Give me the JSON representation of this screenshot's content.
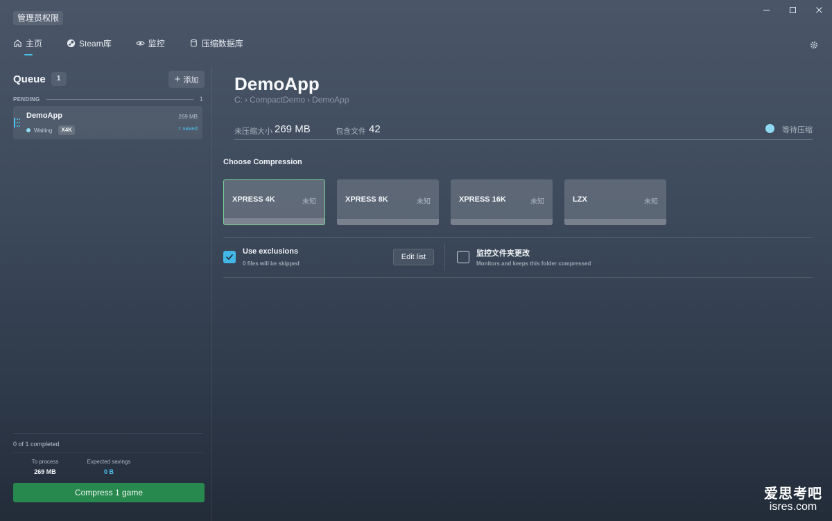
{
  "titlebar": {
    "admin_badge": "管理员权限"
  },
  "nav": {
    "items": [
      {
        "label": "主页",
        "icon": "home-icon",
        "active": true
      },
      {
        "label": "Steam库",
        "icon": "steam-icon"
      },
      {
        "label": "监控",
        "icon": "eye-icon"
      },
      {
        "label": "压缩数据库",
        "icon": "database-icon"
      }
    ]
  },
  "sidebar": {
    "queue_title": "Queue",
    "queue_count": "1",
    "add_label": "添加",
    "pending_label": "PENDING",
    "pending_count": "1",
    "items": [
      {
        "name": "DemoApp",
        "size": "269 MB",
        "status": "Waiting",
        "algorithm": "X4K",
        "saved": "≈ saved"
      }
    ],
    "completed": "0 of 1 completed",
    "to_process_label": "To process",
    "to_process_value": "269 MB",
    "savings_label": "Expected savings",
    "savings_value": "0 B",
    "compress_label": "Compress 1 game"
  },
  "main": {
    "title": "DemoApp",
    "path": [
      "C:",
      "›",
      "CompactDemo",
      "›",
      "DemoApp"
    ],
    "uncompressed_label": "未压缩大小",
    "uncompressed_value": "269 MB",
    "files_label": "包含文件",
    "files_value": "42",
    "status_text": "等待压缩",
    "choose_title": "Choose Compression",
    "algorithms": [
      {
        "name": "XPRESS 4K",
        "estimate": "未知",
        "selected": true
      },
      {
        "name": "XPRESS 8K",
        "estimate": "未知"
      },
      {
        "name": "XPRESS 16K",
        "estimate": "未知"
      },
      {
        "name": "LZX",
        "estimate": "未知"
      }
    ],
    "exclusions_title": "Use exclusions",
    "exclusions_sub": "0 files will be skipped",
    "edit_list_label": "Edit list",
    "monitor_title": "监控文件夹更改",
    "monitor_sub": "Monitors and keeps this folder compressed"
  },
  "watermark": {
    "cn": "爱思考吧",
    "en": "isres.com"
  },
  "colors": {
    "accent": "#4cc2ef",
    "primary_button": "#27894d",
    "selected_border": "#7bd39a",
    "status_dot": "#8fdaf2"
  }
}
